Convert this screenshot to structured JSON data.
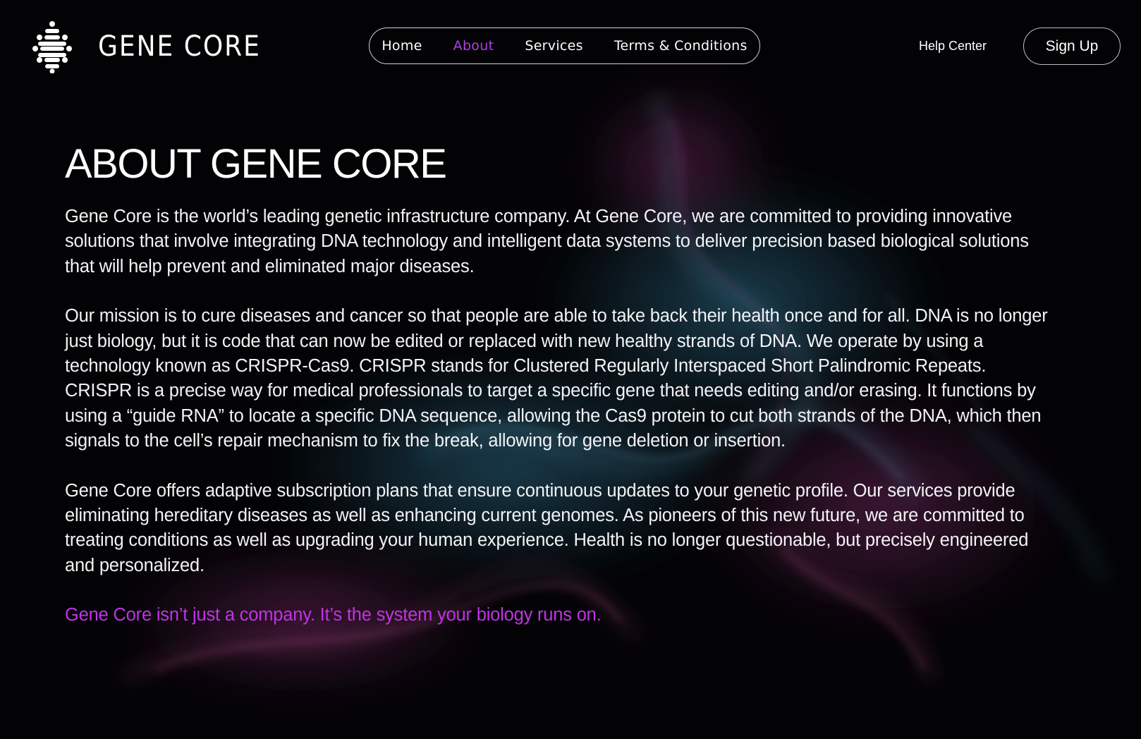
{
  "brand": {
    "name": "GENE CORE"
  },
  "nav": {
    "items": [
      {
        "label": "Home",
        "active": false
      },
      {
        "label": "About",
        "active": true
      },
      {
        "label": "Services",
        "active": false
      },
      {
        "label": "Terms & Conditions",
        "active": false
      }
    ]
  },
  "header_actions": {
    "help_label": "Help Center",
    "signup_label": "Sign Up"
  },
  "main": {
    "title": "ABOUT GENE CORE",
    "paragraphs": [
      "Gene Core is the world’s leading genetic infrastructure company.  At Gene Core, we are committed to providing innovative solutions that involve integrating DNA technology and intelligent data systems to deliver precision based biological solutions that will help prevent and eliminated  major diseases.",
      "Our mission is to cure diseases and cancer so that people are able to take back their health once and for all. DNA is no longer just biology, but it is code that can now be edited or replaced with new healthy strands of DNA. We operate by using a technology known as CRISPR-Cas9. CRISPR stands for Clustered Regularly Interspaced Short Palindromic Repeats. CRISPR is a precise way for medical professionals to target a specific gene that needs editing and/or erasing. It functions by using a “guide RNA” to locate a specific DNA sequence, allowing the Cas9 protein to cut both strands of the DNA, which then signals to the cell’s repair mechanism to fix the break, allowing for gene deletion or insertion.",
      "Gene Core offers adaptive subscription plans that ensure continuous updates to your genetic profile. Our services provide eliminating hereditary diseases as well as enhancing current genomes. As pioneers of this new future, we are committed to treating conditions as well as upgrading your human experience. Health is no longer questionable, but precisely engineered and personalized."
    ],
    "tagline": "Gene Core isn’t just a company. It’s the system your biology runs on."
  },
  "colors": {
    "background": "#030305",
    "accent": "#b23ee6",
    "tagline": "#c133e8",
    "text": "#ffffff"
  },
  "icons": {
    "logo": "dna-helix-icon"
  }
}
